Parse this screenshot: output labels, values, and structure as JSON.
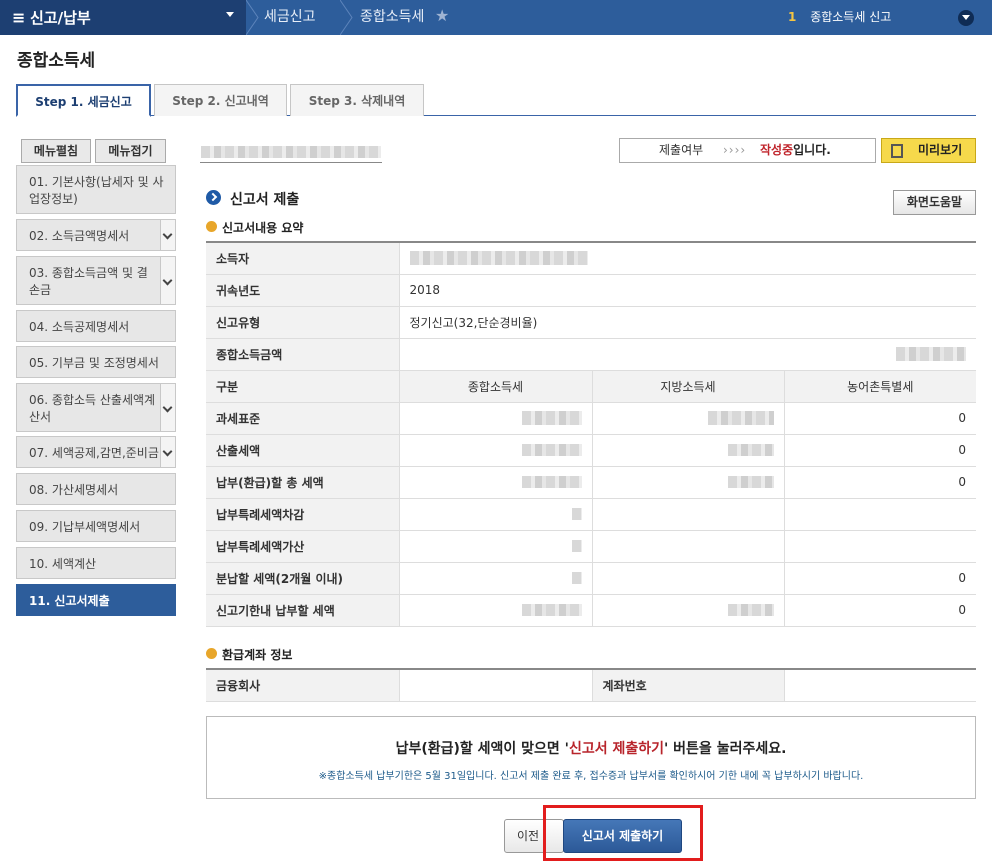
{
  "topbar": {
    "menu_label": "신고/납부",
    "crumbs": [
      "세금신고",
      "종합소득세"
    ],
    "notice_num": "1",
    "notice_text": "종합소득세 신고"
  },
  "page": {
    "title": "종합소득세"
  },
  "tabs": [
    {
      "label": "Step 1. 세금신고",
      "active": true
    },
    {
      "label": "Step 2. 신고내역",
      "active": false
    },
    {
      "label": "Step 3. 삭제내역",
      "active": false
    }
  ],
  "sidebar": {
    "expand_label": "메뉴펼침",
    "collapse_label": "메뉴접기",
    "items": [
      {
        "label": "01. 기본사항(납세자 및 사업장정보)"
      },
      {
        "label": "02. 소득금액명세서"
      },
      {
        "label": "03. 종합소득금액 및 결손금"
      },
      {
        "label": "04. 소득공제명세서"
      },
      {
        "label": "05. 기부금 및 조정명세서"
      },
      {
        "label": "06. 종합소득 산출세액계산서"
      },
      {
        "label": "07. 세액공제,감면,준비금"
      },
      {
        "label": "08. 가산세명세서"
      },
      {
        "label": "09. 기납부세액명세서"
      },
      {
        "label": "10. 세액계산"
      },
      {
        "label": "11. 신고서제출"
      }
    ]
  },
  "status": {
    "label": "제출여부",
    "arrows": "››››",
    "value_red": "작성중",
    "value_rest": "입니다."
  },
  "preview_label": "미리보기",
  "section": {
    "title": "신고서 제출",
    "help_label": "화면도움말",
    "summary_title": "신고서내용 요약",
    "refund_title": "환급계좌 정보"
  },
  "summary": {
    "taxpayer_label": "소득자",
    "year_label": "귀속년도",
    "year_value": "2018",
    "type_label": "신고유형",
    "type_value": "정기신고(32,단순경비율)",
    "income_label": "종합소득금액",
    "col_head": [
      "구분",
      "종합소득세",
      "지방소득세",
      "농어촌특별세"
    ],
    "rows": [
      {
        "label": "과세표준",
        "rural": "0"
      },
      {
        "label": "산출세액",
        "rural": "0"
      },
      {
        "label": "납부(환급)할 총 세액",
        "rural": "0"
      },
      {
        "label": "납부특례세액차감",
        "rural": ""
      },
      {
        "label": "납부특례세액가산",
        "rural": ""
      },
      {
        "label": "분납할 세액(2개월 이내)",
        "rural": "0"
      },
      {
        "label": "신고기한내 납부할 세액",
        "rural": "0"
      }
    ]
  },
  "refund": {
    "bank_label": "금융회사",
    "account_label": "계좌번호"
  },
  "notice": {
    "msg_before": "납부(환급)할 세액이 맞으면 '",
    "msg_red": "신고서 제출하기",
    "msg_after": "' 버튼을 눌러주세요.",
    "sub": "※종합소득세 납부기한은 5월 31일입니다. 신고서 제출 완료 후, 접수증과 납부서를 확인하시어 기한 내에 꼭 납부하시기 바랍니다."
  },
  "buttons": {
    "prev_label": "이전",
    "submit_label": "신고서 제출하기"
  }
}
